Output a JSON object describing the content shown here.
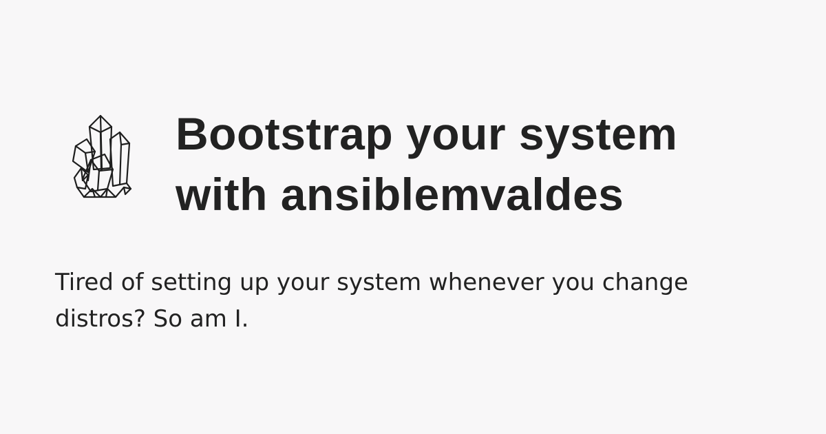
{
  "logo": {
    "icon": "crystal-icon"
  },
  "title": {
    "line1": "Bootstrap your system",
    "line2": "with ansiblemvaldes"
  },
  "description": {
    "line1": "Tired of setting up your system whenever you change",
    "line2": "distros? So am I."
  },
  "colors": {
    "background": "#f8f7f8",
    "text": "#222222"
  }
}
